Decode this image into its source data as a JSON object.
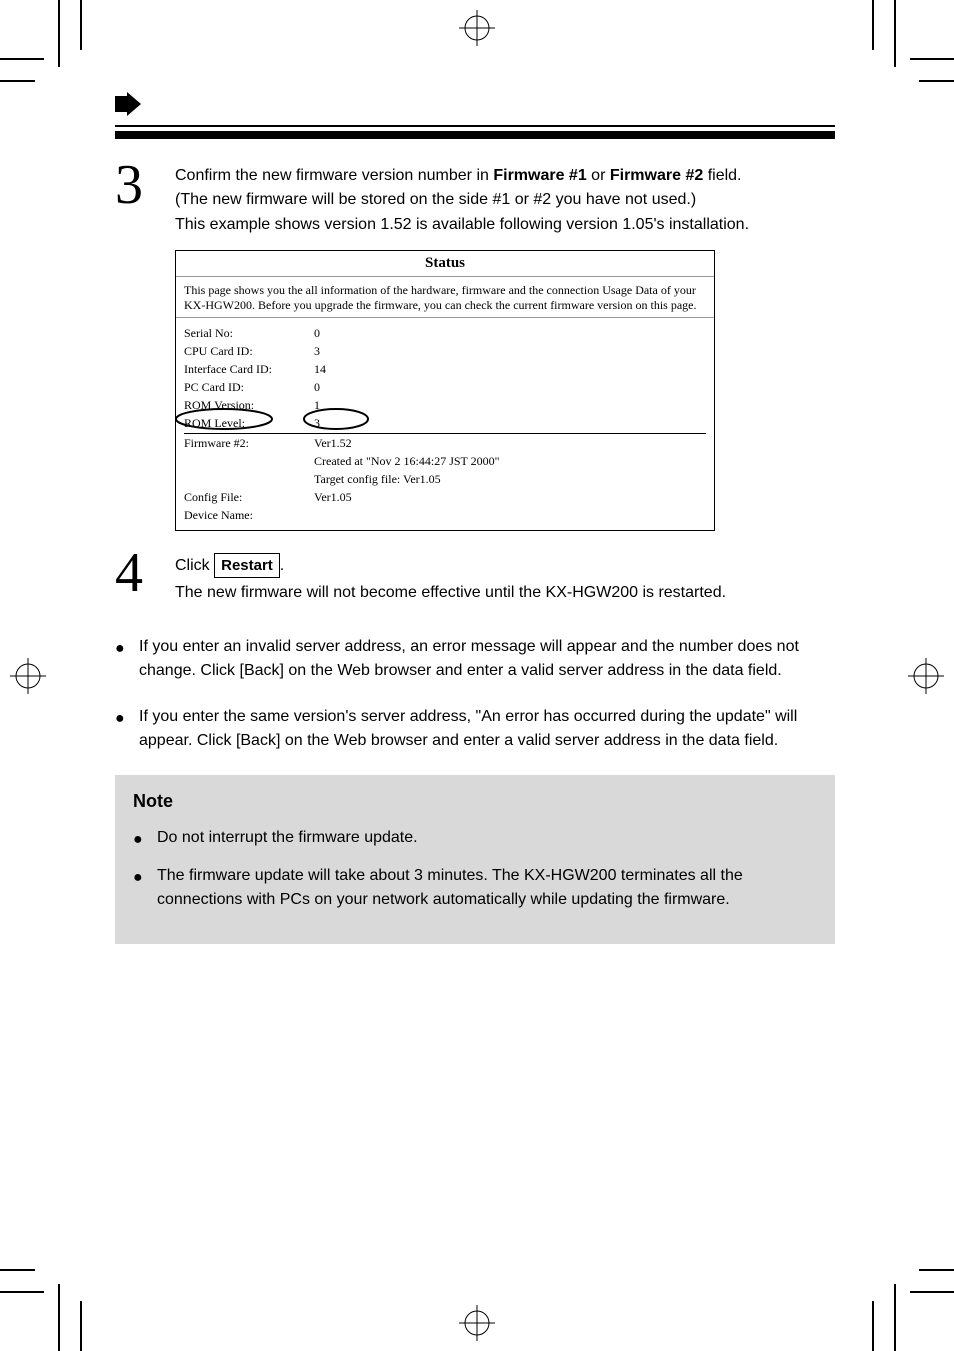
{
  "header": {},
  "step3": {
    "num": "3",
    "text_before": "Confirm the new firmware version number in ",
    "bold": "Firmware #1",
    "text_mid": " or ",
    "bold2": "Firmware #2",
    "text_after": " field.",
    "sub1": "(The new firmware will be stored on the side #1 or #2 you have not used.)",
    "sub2": "This example shows version 1.52 is available following version 1.05's installation."
  },
  "screenshot": {
    "title": "Status",
    "desc": "This page shows you the all information of the hardware, firmware and the connection Usage Data of your KX-HGW200. Before you upgrade the firmware, you can check the current firmware version on this page.",
    "rows": [
      {
        "label": "Serial No:",
        "value": "0"
      },
      {
        "label": "CPU Card ID:",
        "value": "3"
      },
      {
        "label": "Interface Card ID:",
        "value": "14"
      },
      {
        "label": "PC Card ID:",
        "value": "0"
      },
      {
        "label": "ROM Version:",
        "value": "1"
      },
      {
        "label": "ROM Level:",
        "value": "3"
      },
      {
        "label": "Firmware #2:",
        "value": "Ver1.52"
      }
    ],
    "sub_lines": [
      "Created at \"Nov 2 16:44:27 JST 2000\"",
      "Target config file: Ver1.05"
    ],
    "footer_rows": [
      {
        "label": "Config File:",
        "value": "Ver1.05"
      },
      {
        "label": "Device Name:",
        "value": ""
      }
    ]
  },
  "step4": {
    "num": "4",
    "text_before": "Click ",
    "button": "Restart",
    "text_after": ".",
    "sub": "The new firmware will not become effective until the KX-HGW200 is restarted."
  },
  "bullets": [
    "If you enter an invalid server address, an error message will appear and the number does not change. Click [Back] on the Web browser and enter a valid server address in the data field.",
    "If you enter the same version's server address, \"An error has occurred during the update\" will appear. Click [Back] on the Web browser and enter a valid server address in the data field."
  ],
  "note": {
    "title": "Note",
    "items": [
      "Do not interrupt the firmware update.",
      "The firmware update will take about 3 minutes. The KX-HGW200 terminates all the connections with PCs on your network automatically while updating the firmware."
    ]
  }
}
